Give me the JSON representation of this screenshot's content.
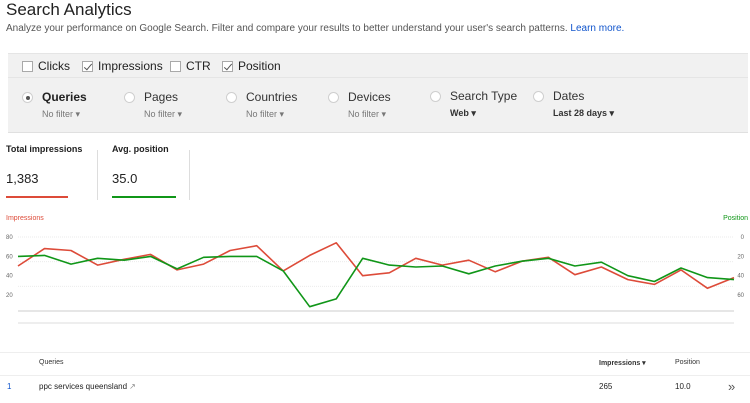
{
  "header": {
    "title": "Search Analytics",
    "subtitle": "Analyze your performance on Google Search. Filter and compare your results to better understand your user's search patterns.",
    "learn_more": "Learn more."
  },
  "metrics": [
    {
      "label": "Clicks",
      "checked": false
    },
    {
      "label": "Impressions",
      "checked": true
    },
    {
      "label": "CTR",
      "checked": false
    },
    {
      "label": "Position",
      "checked": true
    }
  ],
  "filters": [
    {
      "label": "Queries",
      "value": "No filter",
      "selected": true
    },
    {
      "label": "Pages",
      "value": "No filter",
      "selected": false
    },
    {
      "label": "Countries",
      "value": "No filter",
      "selected": false
    },
    {
      "label": "Devices",
      "value": "No filter",
      "selected": false
    },
    {
      "label": "Search Type",
      "value": "Web",
      "selected": false
    },
    {
      "label": "Dates",
      "value": "Last 28 days",
      "selected": false
    }
  ],
  "totals": {
    "impressions_label": "Total impressions",
    "impressions_value": "1,383",
    "position_label": "Avg. position",
    "position_value": "35.0"
  },
  "colors": {
    "impressions": "#dd4b39",
    "position": "#109618",
    "link": "#1155cc"
  },
  "chart_data": {
    "type": "line",
    "left_axis_label": "Impressions",
    "right_axis_label": "Position",
    "left_ticks": [
      "80",
      "60",
      "40",
      "20"
    ],
    "right_ticks": [
      "0",
      "20",
      "40",
      "60"
    ],
    "ylim_left": [
      0,
      80
    ],
    "ylim_right": [
      0,
      80
    ],
    "series": [
      {
        "name": "Impressions",
        "axis": "left",
        "values": [
          50,
          68,
          66,
          51,
          57,
          62,
          46,
          52,
          66,
          71,
          45,
          61,
          74,
          40,
          43,
          58,
          51,
          56,
          44,
          55,
          59,
          41,
          49,
          36,
          31,
          46,
          27,
          38
        ]
      },
      {
        "name": "Position",
        "axis": "right",
        "values": [
          20,
          19,
          28,
          22,
          24,
          20,
          33,
          21,
          20,
          20,
          35,
          72,
          64,
          22,
          29,
          31,
          30,
          38,
          30,
          25,
          22,
          30,
          26,
          40,
          46,
          32,
          42,
          44
        ]
      }
    ]
  },
  "table": {
    "columns": {
      "query": "Queries",
      "impressions": "Impressions ▾",
      "position": "Position"
    },
    "rows": [
      {
        "index": "1",
        "query": "ppc services queensland",
        "impressions": "265",
        "position": "10.0"
      }
    ]
  }
}
